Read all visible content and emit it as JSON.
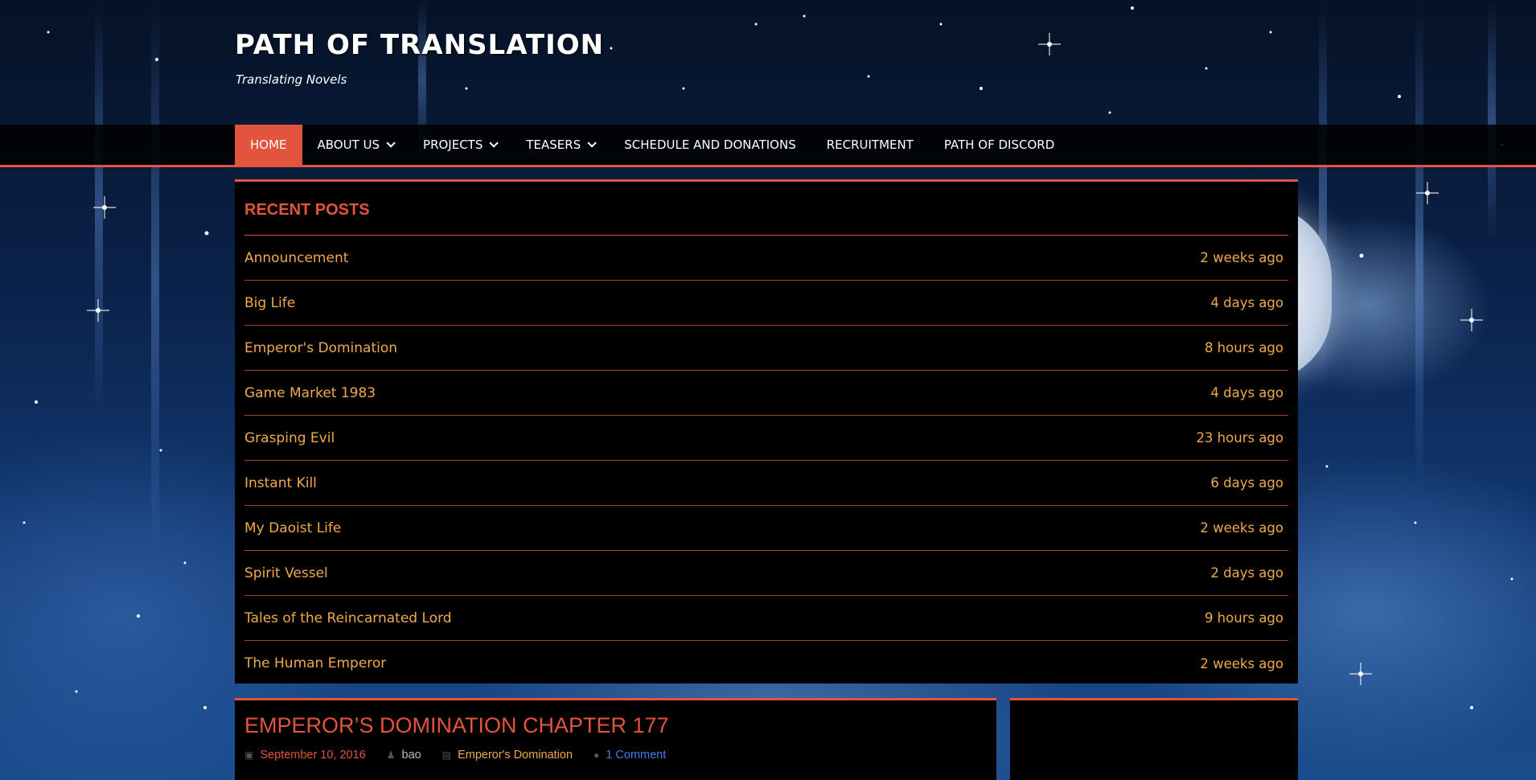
{
  "site": {
    "title": "PATH OF TRANSLATION",
    "description": "Translating Novels"
  },
  "nav": {
    "items": [
      {
        "label": "HOME",
        "active": true,
        "dropdown": false
      },
      {
        "label": "ABOUT US",
        "active": false,
        "dropdown": true
      },
      {
        "label": "PROJECTS",
        "active": false,
        "dropdown": true
      },
      {
        "label": "TEASERS",
        "active": false,
        "dropdown": true
      },
      {
        "label": "SCHEDULE AND DONATIONS",
        "active": false,
        "dropdown": false
      },
      {
        "label": "RECRUITMENT",
        "active": false,
        "dropdown": false
      },
      {
        "label": "PATH OF DISCORD",
        "active": false,
        "dropdown": false
      }
    ]
  },
  "recent_posts": {
    "title": "RECENT POSTS",
    "items": [
      {
        "title": "Announcement",
        "time": "2 weeks ago"
      },
      {
        "title": "Big Life",
        "time": "4 days ago"
      },
      {
        "title": "Emperor's Domination",
        "time": "8 hours ago"
      },
      {
        "title": "Game Market 1983",
        "time": "4 days ago"
      },
      {
        "title": "Grasping Evil",
        "time": "23 hours ago"
      },
      {
        "title": "Instant Kill",
        "time": "6 days ago"
      },
      {
        "title": "My Daoist Life",
        "time": "2 weeks ago"
      },
      {
        "title": "Spirit Vessel",
        "time": "2 days ago"
      },
      {
        "title": "Tales of the Reincarnated Lord",
        "time": "9 hours ago"
      },
      {
        "title": "The Human Emperor",
        "time": "2 weeks ago"
      }
    ]
  },
  "article": {
    "title": "EMPEROR’S DOMINATION CHAPTER 177",
    "date": "September 10, 2016",
    "author": "bao",
    "category": "Emperor's Domination",
    "comments": "1 Comment"
  },
  "colors": {
    "accent": "#e2553c",
    "link": "#f0a94c",
    "comment_link": "#3f7cf0"
  },
  "icons": {
    "date": "calendar-icon",
    "author": "user-icon",
    "category": "folder-icon",
    "comments": "comment-icon"
  }
}
